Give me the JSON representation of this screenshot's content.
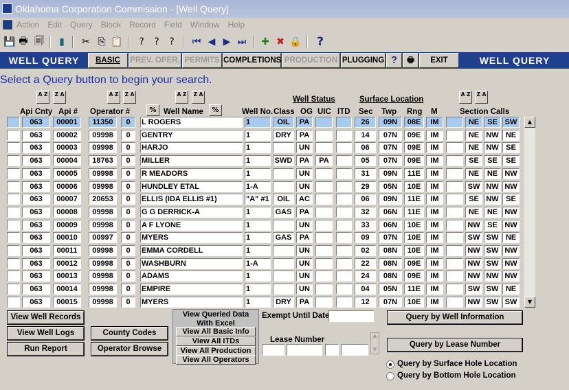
{
  "window": {
    "title": "Oklahoma Corporation Commission - [Well Query]"
  },
  "menu": [
    "Action",
    "Edit",
    "Query",
    "Block",
    "Record",
    "Field",
    "Window",
    "Help"
  ],
  "nav": {
    "left_title": "WELL QUERY",
    "right_title": "WELL QUERY",
    "buttons": [
      "BASIC",
      "PREV. OPER.",
      "PERMITS",
      "COMPLETIONS",
      "PRODUCTION",
      "PLUGGING",
      "?",
      "",
      "EXIT"
    ]
  },
  "prompt": "Select a Query button to begin your search.",
  "sort": {
    "az": "A Z",
    "za": "Z A"
  },
  "headers": {
    "well_status": "Well Status",
    "surface_location": "Surface Location",
    "api_cnty": "Api Cnty",
    "api_no": "Api #",
    "operator": "Operator #",
    "pct": "%",
    "well_name": "Well Name",
    "well_no": "Well No.",
    "class": "Class",
    "og": "OG",
    "uic": "UIC",
    "itd": "ITD",
    "sec": "Sec",
    "twp": "Twp",
    "rng": "Rng",
    "m": "M",
    "section_calls": "Section Calls"
  },
  "rows": [
    {
      "cnty": "063",
      "api": "00001",
      "op": "11350",
      "z": "0",
      "name": "L ROGERS",
      "no": "1",
      "cls": "OIL",
      "og": "PA",
      "uic": "",
      "itd": "",
      "sec": "26",
      "twp": "09N",
      "rng": "08E",
      "m": "IM",
      "x": "",
      "c1": "NE",
      "c2": "SE",
      "c3": "SW"
    },
    {
      "cnty": "063",
      "api": "00002",
      "op": "09998",
      "z": "0",
      "name": "GENTRY",
      "no": "1",
      "cls": "DRY",
      "og": "PA",
      "uic": "",
      "itd": "",
      "sec": "14",
      "twp": "07N",
      "rng": "09E",
      "m": "IM",
      "x": "",
      "c1": "NE",
      "c2": "NW",
      "c3": "NE"
    },
    {
      "cnty": "063",
      "api": "00003",
      "op": "09998",
      "z": "0",
      "name": "HARJO",
      "no": "1",
      "cls": "",
      "og": "UN",
      "uic": "",
      "itd": "",
      "sec": "06",
      "twp": "07N",
      "rng": "09E",
      "m": "IM",
      "x": "",
      "c1": "NE",
      "c2": "NW",
      "c3": "SE"
    },
    {
      "cnty": "063",
      "api": "00004",
      "op": "18763",
      "z": "0",
      "name": "MILLER",
      "no": "1",
      "cls": "SWD",
      "og": "PA",
      "uic": "PA",
      "itd": "",
      "sec": "05",
      "twp": "07N",
      "rng": "09E",
      "m": "IM",
      "x": "",
      "c1": "SE",
      "c2": "SE",
      "c3": "SE"
    },
    {
      "cnty": "063",
      "api": "00005",
      "op": "09998",
      "z": "0",
      "name": "R MEADORS",
      "no": "1",
      "cls": "",
      "og": "UN",
      "uic": "",
      "itd": "",
      "sec": "31",
      "twp": "09N",
      "rng": "11E",
      "m": "IM",
      "x": "",
      "c1": "NE",
      "c2": "NE",
      "c3": "NW"
    },
    {
      "cnty": "063",
      "api": "00006",
      "op": "09998",
      "z": "0",
      "name": "HUNDLEY ETAL",
      "no": "1-A",
      "cls": "",
      "og": "UN",
      "uic": "",
      "itd": "",
      "sec": "29",
      "twp": "05N",
      "rng": "10E",
      "m": "IM",
      "x": "",
      "c1": "SW",
      "c2": "NW",
      "c3": "NW"
    },
    {
      "cnty": "063",
      "api": "00007",
      "op": "20653",
      "z": "0",
      "name": "ELLIS (IDA ELLIS #1)",
      "no": "\"A\" #1",
      "cls": "OIL",
      "og": "AC",
      "uic": "",
      "itd": "",
      "sec": "06",
      "twp": "09N",
      "rng": "11E",
      "m": "IM",
      "x": "",
      "c1": "SE",
      "c2": "NW",
      "c3": "SE"
    },
    {
      "cnty": "063",
      "api": "00008",
      "op": "09998",
      "z": "0",
      "name": "G G DERRICK-A",
      "no": "1",
      "cls": "GAS",
      "og": "PA",
      "uic": "",
      "itd": "",
      "sec": "32",
      "twp": "06N",
      "rng": "11E",
      "m": "IM",
      "x": "",
      "c1": "NE",
      "c2": "NE",
      "c3": "NW"
    },
    {
      "cnty": "063",
      "api": "00009",
      "op": "09998",
      "z": "0",
      "name": "A F LYONE",
      "no": "1",
      "cls": "",
      "og": "UN",
      "uic": "",
      "itd": "",
      "sec": "33",
      "twp": "06N",
      "rng": "10E",
      "m": "IM",
      "x": "",
      "c1": "NW",
      "c2": "SE",
      "c3": "NW"
    },
    {
      "cnty": "063",
      "api": "00010",
      "op": "00997",
      "z": "0",
      "name": "MYERS",
      "no": "1",
      "cls": "GAS",
      "og": "PA",
      "uic": "",
      "itd": "",
      "sec": "09",
      "twp": "07N",
      "rng": "10E",
      "m": "IM",
      "x": "",
      "c1": "SW",
      "c2": "SW",
      "c3": "NE"
    },
    {
      "cnty": "063",
      "api": "00011",
      "op": "09998",
      "z": "0",
      "name": "EMMA CORDELL",
      "no": "1",
      "cls": "",
      "og": "UN",
      "uic": "",
      "itd": "",
      "sec": "02",
      "twp": "08N",
      "rng": "10E",
      "m": "IM",
      "x": "",
      "c1": "NW",
      "c2": "SW",
      "c3": "NW"
    },
    {
      "cnty": "063",
      "api": "00012",
      "op": "09998",
      "z": "0",
      "name": "WASHBURN",
      "no": "1-A",
      "cls": "",
      "og": "UN",
      "uic": "",
      "itd": "",
      "sec": "22",
      "twp": "08N",
      "rng": "09E",
      "m": "IM",
      "x": "",
      "c1": "NW",
      "c2": "SW",
      "c3": "NW"
    },
    {
      "cnty": "063",
      "api": "00013",
      "op": "09998",
      "z": "0",
      "name": "ADAMS",
      "no": "1",
      "cls": "",
      "og": "UN",
      "uic": "",
      "itd": "",
      "sec": "24",
      "twp": "08N",
      "rng": "09E",
      "m": "IM",
      "x": "",
      "c1": "NW",
      "c2": "NW",
      "c3": "NW"
    },
    {
      "cnty": "063",
      "api": "00014",
      "op": "09998",
      "z": "0",
      "name": "EMPIRE",
      "no": "1",
      "cls": "",
      "og": "UN",
      "uic": "",
      "itd": "",
      "sec": "04",
      "twp": "05N",
      "rng": "11E",
      "m": "IM",
      "x": "",
      "c1": "SW",
      "c2": "SW",
      "c3": "NE"
    },
    {
      "cnty": "063",
      "api": "00015",
      "op": "09998",
      "z": "0",
      "name": "MYERS",
      "no": "1",
      "cls": "DRY",
      "og": "PA",
      "uic": "",
      "itd": "",
      "sec": "12",
      "twp": "07N",
      "rng": "10E",
      "m": "IM",
      "x": "",
      "c1": "NW",
      "c2": "SW",
      "c3": "SW"
    }
  ],
  "buttons": {
    "view_well_records": "View Well Records",
    "view_well_logs": "View Well Logs",
    "run_report": "Run Report",
    "county_codes": "County Codes",
    "operator_browse": "Operator Browse",
    "query_by_well": "Query by Well Information",
    "query_by_lease": "Query by Lease Number"
  },
  "excel": {
    "title": "View Queried Data With Excel",
    "basic": "View All Basic Info",
    "itds": "View All ITDs",
    "production": "View All Production",
    "operators": "View All Operators"
  },
  "exempt_label": "Exempt Until Date",
  "lease_label": "Lease Number",
  "radios": {
    "surface": "Query by Surface Hole Location",
    "bottom": "Query by Bottom Hole Location",
    "selected": "surface"
  },
  "colors": {
    "nav_bg": "#1f3f8f",
    "prompt": "#1c2fa0",
    "selected_row": "#a6caf0"
  }
}
